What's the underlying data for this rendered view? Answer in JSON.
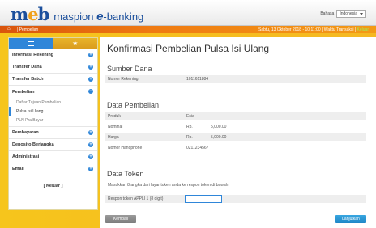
{
  "header": {
    "logo_mark_m": "m",
    "logo_mark_e": "e",
    "logo_mark_b": "b",
    "brand": "maspion",
    "brand_e": "e",
    "brand_rest": "-banking",
    "language_label": "Bahasa",
    "language_value": "Indonesia"
  },
  "topbar": {
    "crumb": "Pembelian",
    "session_text": "Sabtu, 13 Oktober 2018 - 10:11:00 | Waktu Transaksi",
    "logout_link": "Keluar"
  },
  "sidebar": {
    "items": [
      {
        "label": "Informasi Rekening"
      },
      {
        "label": "Transfer Dana"
      },
      {
        "label": "Transfer Batch"
      },
      {
        "label": "Pembelian"
      },
      {
        "label": "Pembayaran"
      },
      {
        "label": "Deposito Berjangka"
      },
      {
        "label": "Administrasi"
      },
      {
        "label": "Email"
      }
    ],
    "sub_items": [
      {
        "label": "Daftar Tujuan Pembelian"
      },
      {
        "label": "Pulsa Isi Ulang"
      },
      {
        "label": "PLN Pra Bayar"
      }
    ],
    "logout": "[ Keluar ]"
  },
  "main": {
    "title": "Konfirmasi Pembelian Pulsa Isi Ulang",
    "source": {
      "title": "Sumber Dana",
      "account_label": "Nomor Rekening",
      "account_value": "1011611884"
    },
    "purchase": {
      "title": "Data Pembelian",
      "product_label": "Produk",
      "product_value": "Esia",
      "nominal_label": "Nominal",
      "nominal_currency": "Rp.",
      "nominal_value": "5,000.00",
      "price_label": "Harga",
      "price_currency": "Rp.",
      "price_value": "5,000.00",
      "phone_label": "Nomor Handphone",
      "phone_value": "0211234567"
    },
    "token": {
      "title": "Data Token",
      "instruction": "Masukkan 8 angka dari layar token anda ke respon token di bawah",
      "response_label": "Respon token APPLI 1 (8 digit)",
      "response_value": ""
    },
    "buttons": {
      "back": "Kembali",
      "next": "Lanjutkan"
    }
  }
}
